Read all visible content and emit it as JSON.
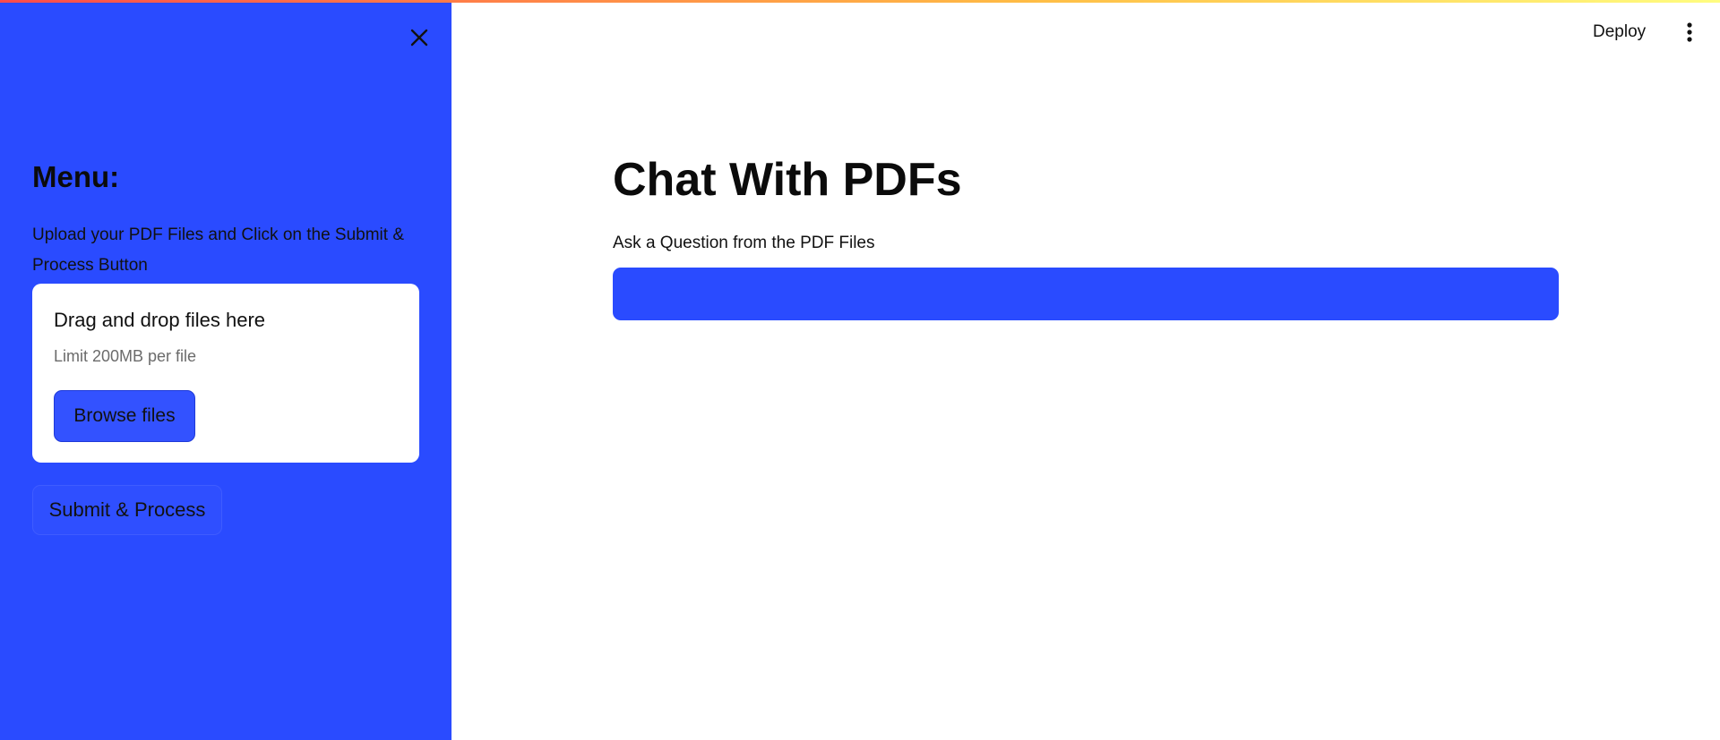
{
  "sidebar": {
    "close_icon": "close-icon",
    "heading": "Menu:",
    "description": "Upload your PDF Files and Click on the Submit & Process Button",
    "uploader": {
      "title": "Drag and drop files here",
      "limit": "Limit 200MB per file",
      "browse_label": "Browse files"
    },
    "submit_label": "Submit & Process",
    "background_color": "#2a4bff"
  },
  "header": {
    "deploy_label": "Deploy",
    "menu_icon": "kebab-menu-icon"
  },
  "main": {
    "title": "Chat With PDFs",
    "question_label": "Ask a Question from the PDF Files",
    "question_value": "",
    "input_color": "#2a4bff"
  }
}
